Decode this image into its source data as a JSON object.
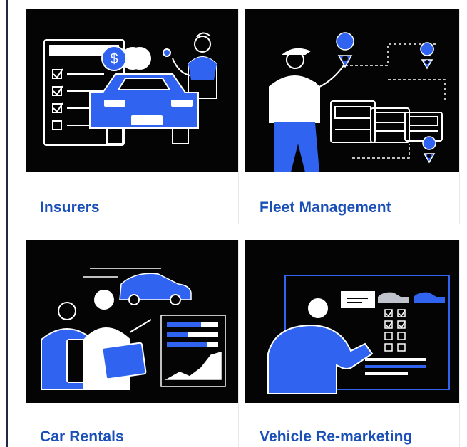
{
  "cards": [
    {
      "label": "Insurers",
      "illustration": "insurance-car-illustration"
    },
    {
      "label": "Fleet Management",
      "illustration": "fleet-trucks-map-illustration"
    },
    {
      "label": "Car Rentals",
      "illustration": "car-rental-illustration"
    },
    {
      "label": "Vehicle Re-marketing",
      "illustration": "vehicle-remarketing-illustration"
    }
  ],
  "colors": {
    "accent": "#2f63f0",
    "label": "#1a4fb8",
    "illustration_bg": "#040404",
    "line": "#ffffff"
  }
}
